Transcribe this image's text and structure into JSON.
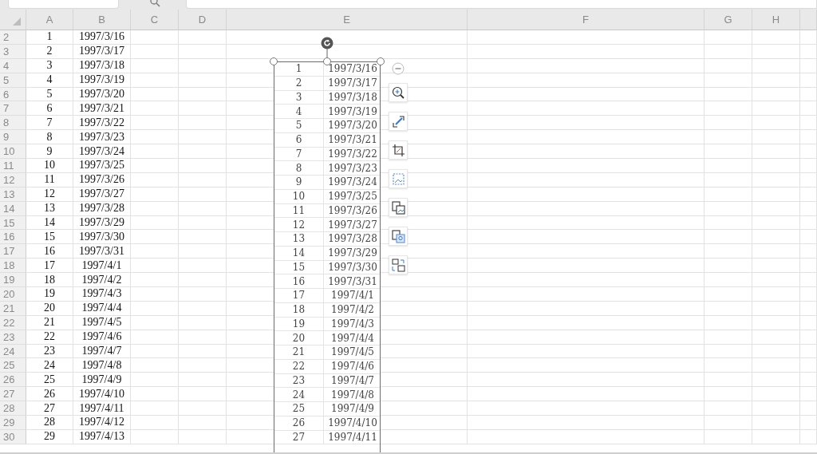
{
  "columns": [
    "A",
    "B",
    "C",
    "D",
    "E",
    "F",
    "G",
    "H"
  ],
  "rows": [
    {
      "header": "2",
      "cells": [
        "1",
        "1997/3/16"
      ]
    },
    {
      "header": "3",
      "cells": [
        "2",
        "1997/3/17"
      ]
    },
    {
      "header": "4",
      "cells": [
        "3",
        "1997/3/18"
      ]
    },
    {
      "header": "5",
      "cells": [
        "4",
        "1997/3/19"
      ]
    },
    {
      "header": "6",
      "cells": [
        "5",
        "1997/3/20"
      ]
    },
    {
      "header": "7",
      "cells": [
        "6",
        "1997/3/21"
      ]
    },
    {
      "header": "8",
      "cells": [
        "7",
        "1997/3/22"
      ]
    },
    {
      "header": "9",
      "cells": [
        "8",
        "1997/3/23"
      ]
    },
    {
      "header": "10",
      "cells": [
        "9",
        "1997/3/24"
      ]
    },
    {
      "header": "11",
      "cells": [
        "10",
        "1997/3/25"
      ]
    },
    {
      "header": "12",
      "cells": [
        "11",
        "1997/3/26"
      ]
    },
    {
      "header": "13",
      "cells": [
        "12",
        "1997/3/27"
      ]
    },
    {
      "header": "14",
      "cells": [
        "13",
        "1997/3/28"
      ]
    },
    {
      "header": "15",
      "cells": [
        "14",
        "1997/3/29"
      ]
    },
    {
      "header": "16",
      "cells": [
        "15",
        "1997/3/30"
      ]
    },
    {
      "header": "17",
      "cells": [
        "16",
        "1997/3/31"
      ]
    },
    {
      "header": "18",
      "cells": [
        "17",
        "1997/4/1"
      ]
    },
    {
      "header": "19",
      "cells": [
        "18",
        "1997/4/2"
      ]
    },
    {
      "header": "20",
      "cells": [
        "19",
        "1997/4/3"
      ]
    },
    {
      "header": "21",
      "cells": [
        "20",
        "1997/4/4"
      ]
    },
    {
      "header": "22",
      "cells": [
        "21",
        "1997/4/5"
      ]
    },
    {
      "header": "23",
      "cells": [
        "22",
        "1997/4/6"
      ]
    },
    {
      "header": "24",
      "cells": [
        "23",
        "1997/4/7"
      ]
    },
    {
      "header": "25",
      "cells": [
        "24",
        "1997/4/8"
      ]
    },
    {
      "header": "26",
      "cells": [
        "25",
        "1997/4/9"
      ]
    },
    {
      "header": "27",
      "cells": [
        "26",
        "1997/4/10"
      ]
    },
    {
      "header": "28",
      "cells": [
        "27",
        "1997/4/11"
      ]
    },
    {
      "header": "29",
      "cells": [
        "28",
        "1997/4/12"
      ]
    },
    {
      "header": "30",
      "cells": [
        "29",
        "1997/4/13"
      ]
    }
  ],
  "inserted_image": {
    "selected": true,
    "rows": [
      [
        "1",
        "1997/3/16"
      ],
      [
        "2",
        "1997/3/17"
      ],
      [
        "3",
        "1997/3/18"
      ],
      [
        "4",
        "1997/3/19"
      ],
      [
        "5",
        "1997/3/20"
      ],
      [
        "6",
        "1997/3/21"
      ],
      [
        "7",
        "1997/3/22"
      ],
      [
        "8",
        "1997/3/23"
      ],
      [
        "9",
        "1997/3/24"
      ],
      [
        "10",
        "1997/3/25"
      ],
      [
        "11",
        "1997/3/26"
      ],
      [
        "12",
        "1997/3/27"
      ],
      [
        "13",
        "1997/3/28"
      ],
      [
        "14",
        "1997/3/29"
      ],
      [
        "15",
        "1997/3/30"
      ],
      [
        "16",
        "1997/3/31"
      ],
      [
        "17",
        "1997/4/1"
      ],
      [
        "18",
        "1997/4/2"
      ],
      [
        "19",
        "1997/4/3"
      ],
      [
        "20",
        "1997/4/4"
      ],
      [
        "21",
        "1997/4/5"
      ],
      [
        "22",
        "1997/4/6"
      ],
      [
        "23",
        "1997/4/7"
      ],
      [
        "24",
        "1997/4/8"
      ],
      [
        "25",
        "1997/4/9"
      ],
      [
        "26",
        "1997/4/10"
      ],
      [
        "27",
        "1997/4/11"
      ]
    ]
  }
}
